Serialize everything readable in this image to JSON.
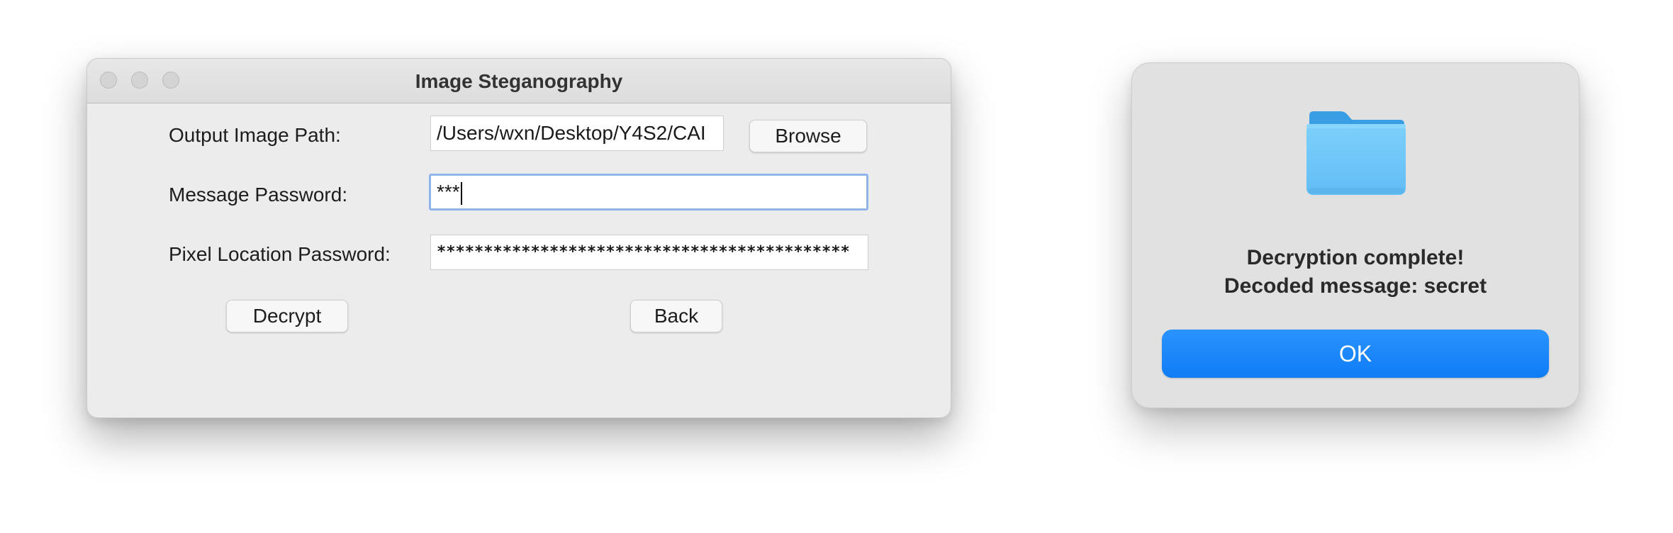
{
  "window": {
    "title": "Image Steganography",
    "output_image_path": {
      "label": "Output Image Path:",
      "value": "/Users/wxn/Desktop/Y4S2/CAI"
    },
    "browse_label": "Browse",
    "message_password": {
      "label": "Message Password:",
      "value": "***"
    },
    "pixel_location_password": {
      "label": "Pixel Location Password:",
      "value": "********************************************"
    },
    "decrypt_label": "Decrypt",
    "back_label": "Back"
  },
  "alert": {
    "icon": "folder-icon",
    "line1": "Decryption complete!",
    "line2": "Decoded message: secret",
    "ok_label": "OK"
  },
  "colors": {
    "window_bg": "#ececec",
    "focus_ring": "#8fb5ea",
    "alert_bg": "#e1e1e1",
    "ok_button": "#1485fb",
    "folder": "#71c7f9"
  }
}
